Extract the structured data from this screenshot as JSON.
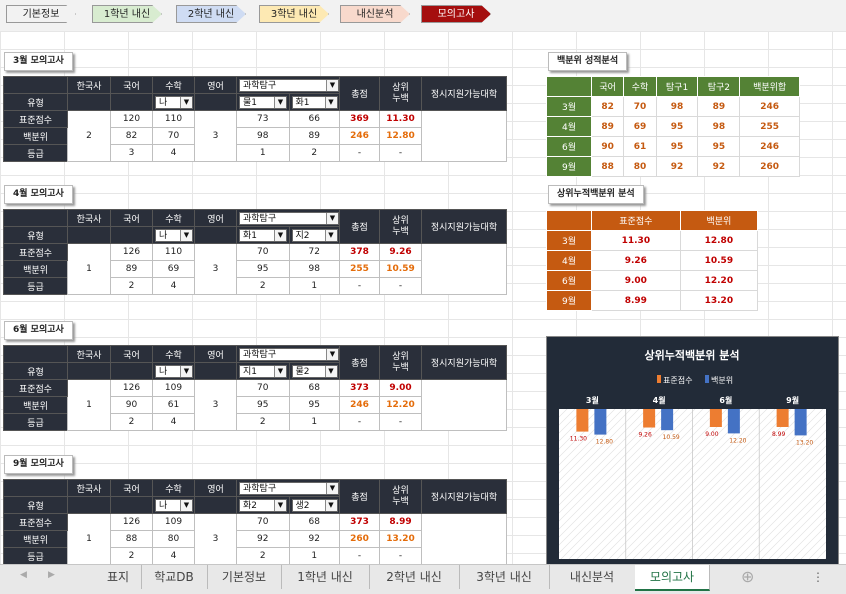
{
  "nav": [
    {
      "label": "기본정보",
      "bg": "#f2f2f2",
      "color": "#222"
    },
    {
      "label": "1학년 내신",
      "bg": "#d8ecd0",
      "color": "#222"
    },
    {
      "label": "2학년 내신",
      "bg": "#cfdcf3",
      "color": "#222"
    },
    {
      "label": "3학년 내신",
      "bg": "#fde9b3",
      "color": "#222"
    },
    {
      "label": "내신분석",
      "bg": "#f8d9cc",
      "color": "#222"
    },
    {
      "label": "모의고사",
      "bg": "#a50e0e",
      "color": "#ffffff"
    }
  ],
  "headers": {
    "type": "유형",
    "korhist": "한국사",
    "kor": "국어",
    "math": "수학",
    "eng": "영어",
    "total": "총점",
    "pct1": "상위",
    "pct2": "누백",
    "univ": "정시지원가능대학",
    "std": "표준점수",
    "pctl": "백분위",
    "grade": "등급",
    "sci": "과학탐구"
  },
  "exams": [
    {
      "label": "3월 모의고사",
      "math_type": "나",
      "t1": "물1",
      "t2": "화1",
      "korhist": "2",
      "eng": "3",
      "std": {
        "kor": "120",
        "math": "110",
        "t1": "73",
        "t2": "66",
        "total": "369",
        "pct": "11.30"
      },
      "pctl": {
        "kor": "82",
        "math": "70",
        "t1": "98",
        "t2": "89",
        "total": "246",
        "pct": "12.80"
      },
      "grade": {
        "kor": "3",
        "math": "4",
        "t1": "1",
        "t2": "2",
        "total": "-",
        "pct": "-"
      }
    },
    {
      "label": "4월 모의고사",
      "math_type": "나",
      "t1": "화1",
      "t2": "지2",
      "korhist": "1",
      "eng": "3",
      "std": {
        "kor": "126",
        "math": "110",
        "t1": "70",
        "t2": "72",
        "total": "378",
        "pct": "9.26"
      },
      "pctl": {
        "kor": "89",
        "math": "69",
        "t1": "95",
        "t2": "98",
        "total": "255",
        "pct": "10.59"
      },
      "grade": {
        "kor": "2",
        "math": "4",
        "t1": "2",
        "t2": "1",
        "total": "-",
        "pct": "-"
      }
    },
    {
      "label": "6월 모의고사",
      "math_type": "나",
      "t1": "지1",
      "t2": "물2",
      "korhist": "1",
      "eng": "3",
      "std": {
        "kor": "126",
        "math": "109",
        "t1": "70",
        "t2": "68",
        "total": "373",
        "pct": "9.00"
      },
      "pctl": {
        "kor": "90",
        "math": "61",
        "t1": "95",
        "t2": "95",
        "total": "246",
        "pct": "12.20"
      },
      "grade": {
        "kor": "2",
        "math": "4",
        "t1": "2",
        "t2": "1",
        "total": "-",
        "pct": "-"
      }
    },
    {
      "label": "9월 모의고사",
      "math_type": "나",
      "t1": "화2",
      "t2": "생2",
      "korhist": "1",
      "eng": "3",
      "std": {
        "kor": "126",
        "math": "109",
        "t1": "70",
        "t2": "68",
        "total": "373",
        "pct": "8.99"
      },
      "pctl": {
        "kor": "88",
        "math": "80",
        "t1": "92",
        "t2": "92",
        "total": "260",
        "pct": "13.20"
      },
      "grade": {
        "kor": "2",
        "math": "4",
        "t1": "2",
        "t2": "1",
        "total": "-",
        "pct": "-"
      }
    }
  ],
  "pct_analysis": {
    "title": "백분위 성적분석",
    "cols": [
      "국어",
      "수학",
      "탐구1",
      "탐구2",
      "백분위합"
    ],
    "rows": [
      {
        "m": "3월",
        "v": [
          "82",
          "70",
          "98",
          "89",
          "246"
        ]
      },
      {
        "m": "4월",
        "v": [
          "89",
          "69",
          "95",
          "98",
          "255"
        ]
      },
      {
        "m": "6월",
        "v": [
          "90",
          "61",
          "95",
          "95",
          "246"
        ]
      },
      {
        "m": "9월",
        "v": [
          "88",
          "80",
          "92",
          "92",
          "260"
        ]
      }
    ]
  },
  "cum_analysis": {
    "title": "상위누적백분위 분석",
    "cols": [
      "표준점수",
      "백분위"
    ],
    "rows": [
      {
        "m": "3월",
        "v": [
          "11.30",
          "12.80"
        ]
      },
      {
        "m": "4월",
        "v": [
          "9.26",
          "10.59"
        ]
      },
      {
        "m": "6월",
        "v": [
          "9.00",
          "12.20"
        ]
      },
      {
        "m": "9월",
        "v": [
          "8.99",
          "13.20"
        ]
      }
    ]
  },
  "chart_data": {
    "type": "bar",
    "title": "상위누적백분위 분석",
    "categories": [
      "3월",
      "4월",
      "6월",
      "9월"
    ],
    "series": [
      {
        "name": "표준점수",
        "values": [
          11.3,
          9.26,
          9.0,
          8.99
        ],
        "color": "#ed7d31"
      },
      {
        "name": "백분위",
        "values": [
          12.8,
          10.59,
          12.2,
          13.2
        ],
        "color": "#4472c4"
      }
    ],
    "legend": "top"
  },
  "tabs": [
    {
      "label": "표지",
      "active": false
    },
    {
      "label": "학교DB",
      "active": false
    },
    {
      "label": "기본정보",
      "active": false
    },
    {
      "label": "1학년 내신",
      "active": false
    },
    {
      "label": "2학년 내신",
      "active": false
    },
    {
      "label": "3학년 내신",
      "active": false
    },
    {
      "label": "내신분석",
      "active": false
    },
    {
      "label": "모의고사",
      "active": true
    }
  ],
  "tabbar_icons": {
    "prev": "◀",
    "next": "▶",
    "add": "⊕",
    "more": "⋮"
  }
}
